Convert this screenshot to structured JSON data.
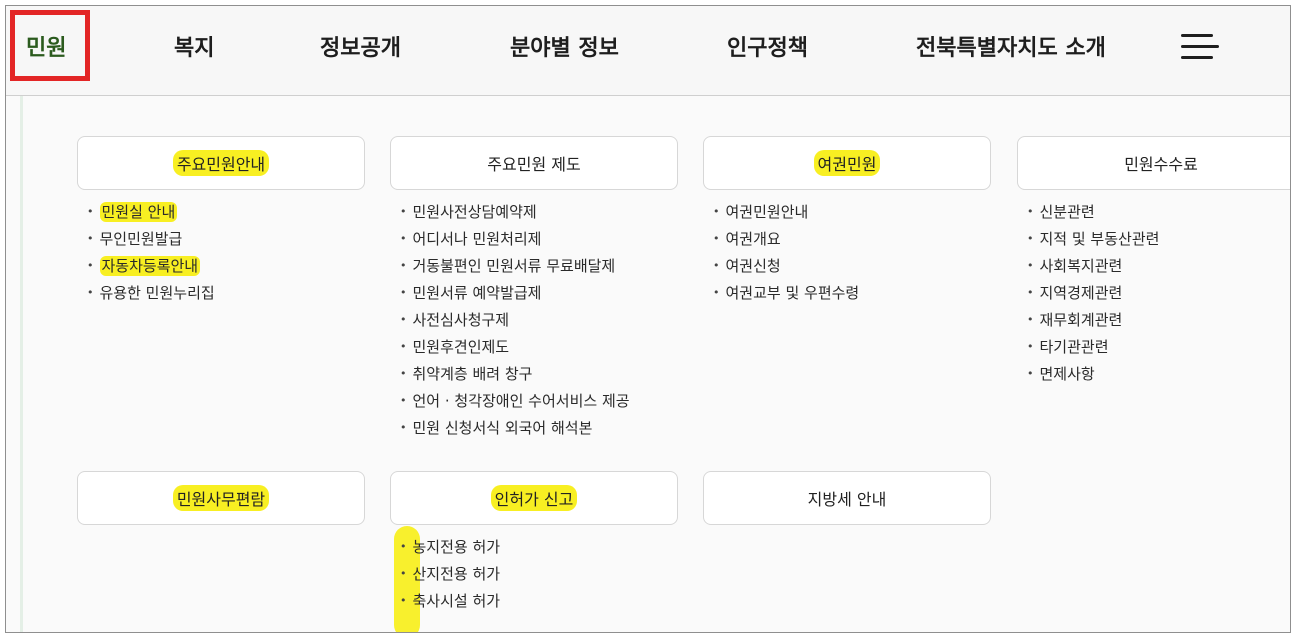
{
  "nav": {
    "items": [
      "민원",
      "복지",
      "정보공개",
      "분야별 정보",
      "인구정책",
      "전북특별자치도 소개"
    ],
    "menu_icon": "hamburger-menu-icon"
  },
  "sections": [
    {
      "title": "주요민원안내",
      "highlighted": true,
      "items": [
        {
          "label": "민원실 안내",
          "highlighted": true
        },
        {
          "label": "무인민원발급",
          "highlighted": false
        },
        {
          "label": "자동차등록안내",
          "highlighted": true
        },
        {
          "label": "유용한 민원누리집",
          "highlighted": false
        }
      ]
    },
    {
      "title": "주요민원 제도",
      "highlighted": false,
      "items": [
        {
          "label": "민원사전상담예약제"
        },
        {
          "label": "어디서나 민원처리제"
        },
        {
          "label": "거동불편인 민원서류 무료배달제"
        },
        {
          "label": "민원서류 예약발급제"
        },
        {
          "label": "사전심사청구제"
        },
        {
          "label": "민원후견인제도"
        },
        {
          "label": "취약계층 배려 창구"
        },
        {
          "label": "언어 · 청각장애인 수어서비스 제공"
        },
        {
          "label": "민원 신청서식 외국어 해석본"
        }
      ]
    },
    {
      "title": "여권민원",
      "highlighted": true,
      "items": [
        {
          "label": "여권민원안내"
        },
        {
          "label": "여권개요"
        },
        {
          "label": "여권신청"
        },
        {
          "label": "여권교부 및 우편수령"
        }
      ]
    },
    {
      "title": "민원수수료",
      "highlighted": false,
      "items": [
        {
          "label": "신분관련"
        },
        {
          "label": "지적 및 부동산관련"
        },
        {
          "label": "사회복지관련"
        },
        {
          "label": "지역경제관련"
        },
        {
          "label": "재무회계관련"
        },
        {
          "label": "타기관관련"
        },
        {
          "label": "면제사항"
        }
      ]
    },
    {
      "title": "민원사무편람",
      "highlighted": true,
      "items": []
    },
    {
      "title": "인허가 신고",
      "highlighted": true,
      "items": [
        {
          "label": "농지전용 허가"
        },
        {
          "label": "산지전용 허가"
        },
        {
          "label": "축사시설 허가"
        }
      ]
    },
    {
      "title": "지방세 안내",
      "highlighted": false,
      "items": []
    }
  ],
  "colors": {
    "highlight": "#f8ef22",
    "active_nav": "#2b5b1e",
    "annotation_box": "#e32626"
  }
}
